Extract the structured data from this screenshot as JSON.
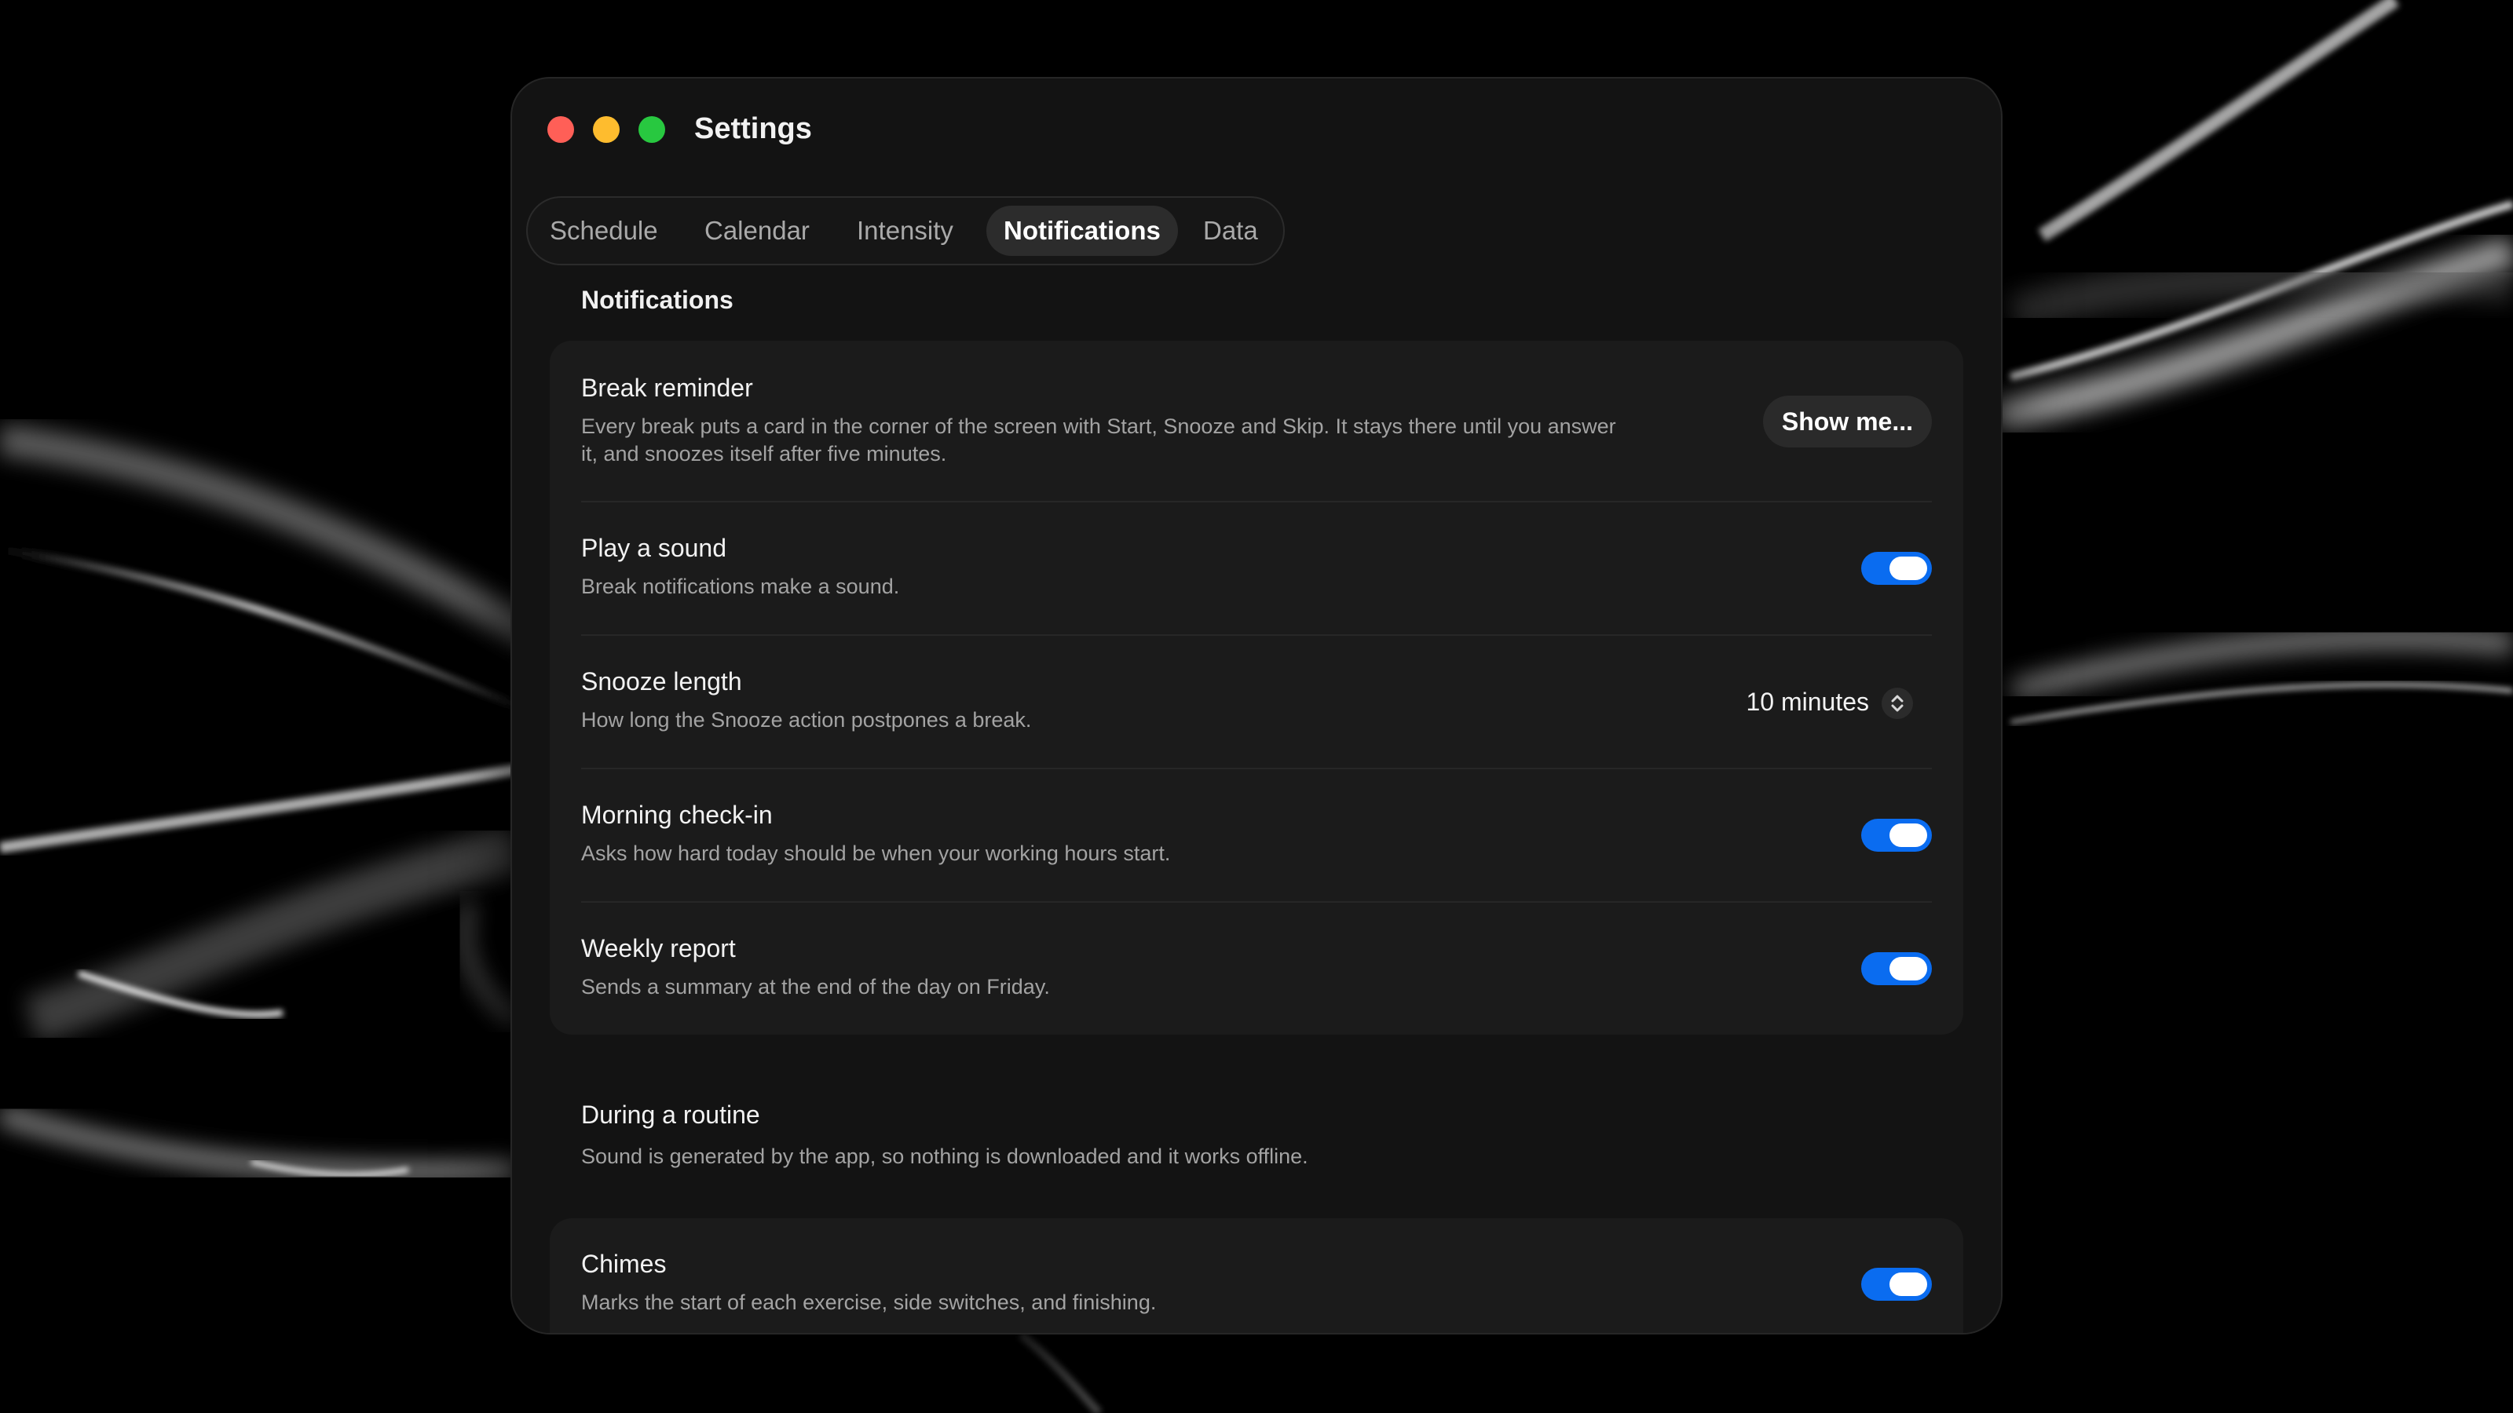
{
  "window": {
    "title": "Settings"
  },
  "tabs": [
    {
      "label": "Schedule",
      "active": false
    },
    {
      "label": "Calendar",
      "active": false
    },
    {
      "label": "Intensity",
      "active": false
    },
    {
      "label": "Notifications",
      "active": true
    },
    {
      "label": "Data",
      "active": false
    }
  ],
  "notifications": {
    "section_title": "Notifications",
    "break_reminder": {
      "title": "Break reminder",
      "desc_line1": "Every break puts a card in the corner of the screen with Start, Snooze and Skip. It stays there until you answer",
      "desc_line2": "it, and snoozes itself after five minutes.",
      "button_label": "Show me..."
    },
    "play_sound": {
      "title": "Play a sound",
      "desc": "Break notifications make a sound.",
      "enabled": true
    },
    "snooze_length": {
      "title": "Snooze length",
      "desc": "How long the Snooze action postpones a break.",
      "value": "10 minutes",
      "icon": "chevron-up-down-icon"
    },
    "morning_checkin": {
      "title": "Morning check-in",
      "desc": "Asks how hard today should be when your working hours start.",
      "enabled": true
    },
    "weekly_report": {
      "title": "Weekly report",
      "desc": "Sends a summary at the end of the day on Friday.",
      "enabled": true
    }
  },
  "routine": {
    "title": "During a routine",
    "desc": "Sound is generated by the app, so nothing is downloaded and it works offline.",
    "chimes": {
      "title": "Chimes",
      "desc": "Marks the start of each exercise, side switches, and finishing.",
      "enabled": true
    }
  },
  "colors": {
    "accent": "#0a6cf0",
    "close": "#ff5f57",
    "minimize": "#febc2e",
    "zoom": "#28c840"
  }
}
